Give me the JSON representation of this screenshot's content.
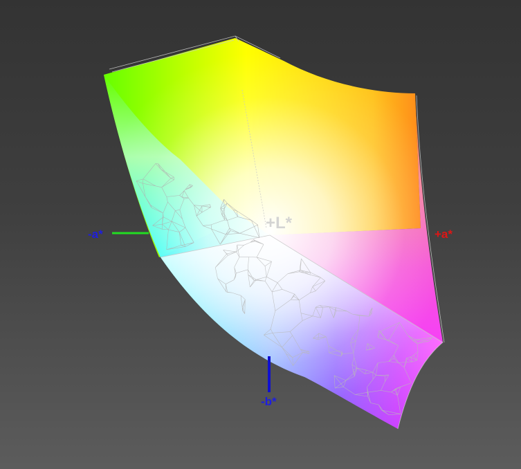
{
  "axes": {
    "neg_a": {
      "label": "-a*",
      "color": "#1e1ee0",
      "line_color": "#22dd22"
    },
    "pos_a": {
      "label": "+a*",
      "color": "#e01515"
    },
    "neg_b": {
      "label": "-b*",
      "color": "#1e1ee0",
      "line_color": "#1010d0"
    },
    "pos_l": {
      "label": "+L*",
      "color": "#d0d0d0"
    }
  },
  "colors": {
    "background_top": "#333333",
    "background_bottom": "#5c5c5c",
    "wireframe": "#c8c8c8",
    "green": "#66ff00",
    "yellow": "#ffff00",
    "orange": "#ff8a1a",
    "magenta": "#ff40ff",
    "cyan": "#00ffff",
    "blue": "#5a6bff",
    "violet": "#c040ff",
    "white_point": "#ffffff"
  }
}
